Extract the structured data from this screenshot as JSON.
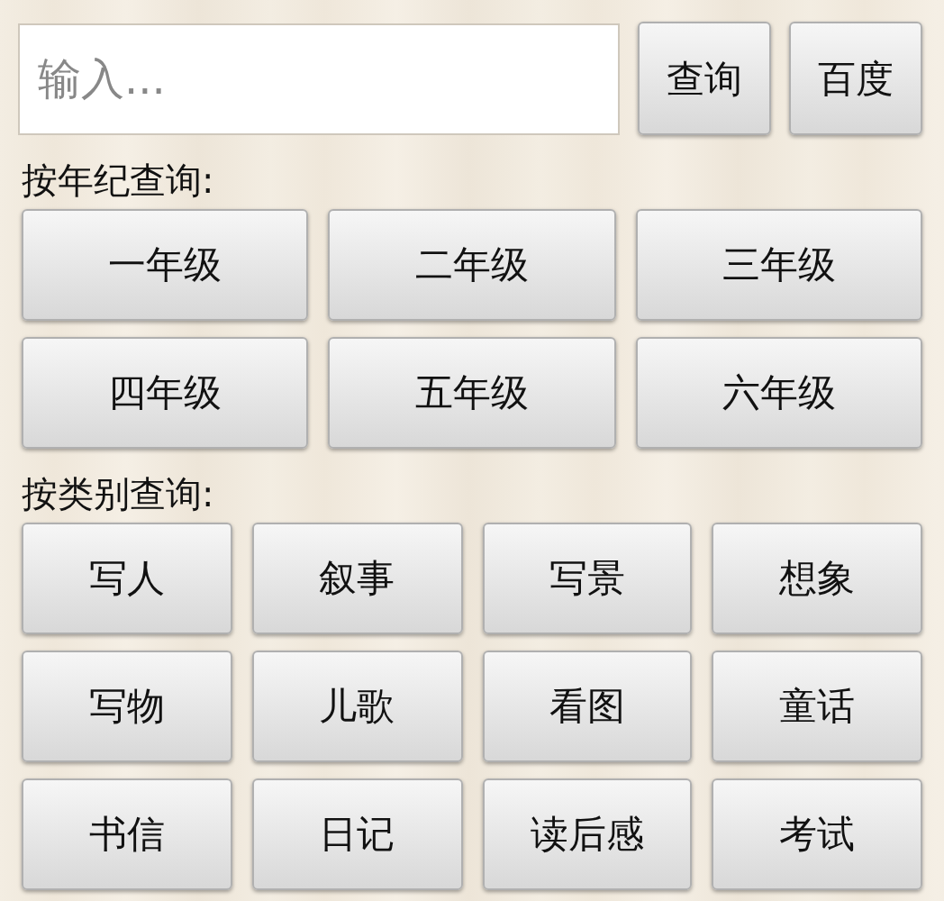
{
  "search": {
    "placeholder": "输入...",
    "buttons": [
      "查询",
      "百度"
    ]
  },
  "sections": [
    {
      "label": "按年纪查询:",
      "kind": "grade",
      "buttons": [
        "一年级",
        "二年级",
        "三年级",
        "四年级",
        "五年级",
        "六年级"
      ]
    },
    {
      "label": "按类别查询:",
      "kind": "category",
      "buttons": [
        "写人",
        "叙事",
        "写景",
        "想象",
        "写物",
        "儿歌",
        "看图",
        "童话",
        "书信",
        "日记",
        "读后感",
        "考试"
      ]
    }
  ]
}
